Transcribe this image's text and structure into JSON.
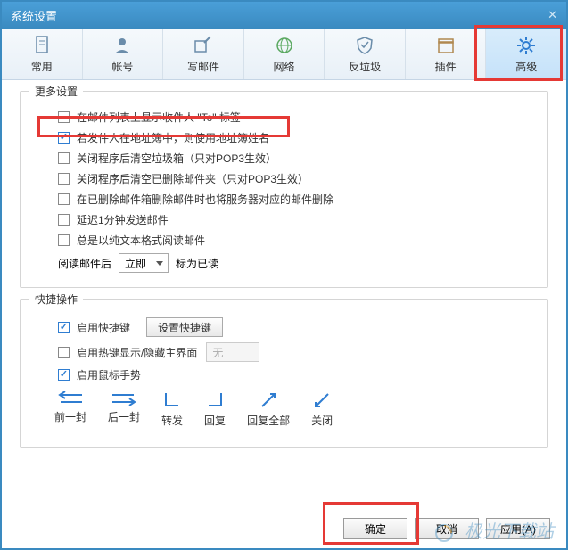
{
  "title": "系统设置",
  "tabs": [
    {
      "label": "常用"
    },
    {
      "label": "帐号"
    },
    {
      "label": "写邮件"
    },
    {
      "label": "网络"
    },
    {
      "label": "反垃圾"
    },
    {
      "label": "插件"
    },
    {
      "label": "高级"
    }
  ],
  "more": {
    "legend": "更多设置",
    "opts": [
      {
        "label": "在邮件列表上显示收件人 \"To\" 标签",
        "checked": false
      },
      {
        "label": "若发件人在地址簿中，则使用地址簿姓名",
        "checked": true
      },
      {
        "label": "关闭程序后清空垃圾箱（只对POP3生效）",
        "checked": false
      },
      {
        "label": "关闭程序后清空已删除邮件夹（只对POP3生效）",
        "checked": false
      },
      {
        "label": "在已删除邮件箱删除邮件时也将服务器对应的邮件删除",
        "checked": false
      },
      {
        "label": "延迟1分钟发送邮件",
        "checked": false
      },
      {
        "label": "总是以纯文本格式阅读邮件",
        "checked": false
      }
    ],
    "readAfter": {
      "pre": "阅读邮件后",
      "value": "立即",
      "post": "标为已读"
    }
  },
  "quick": {
    "legend": "快捷操作",
    "enableShortcut": {
      "label": "启用快捷键",
      "checked": true,
      "btn": "设置快捷键"
    },
    "enableHotkey": {
      "label": "启用热键显示/隐藏主界面",
      "checked": false,
      "value": "无"
    },
    "enableGesture": {
      "label": "启用鼠标手势",
      "checked": true
    },
    "gestures": [
      "前一封",
      "后一封",
      "转发",
      "回复",
      "回复全部",
      "关闭"
    ]
  },
  "buttons": {
    "ok": "确定",
    "cancel": "取消",
    "apply": "应用(A)"
  },
  "watermark": "极光下载站"
}
